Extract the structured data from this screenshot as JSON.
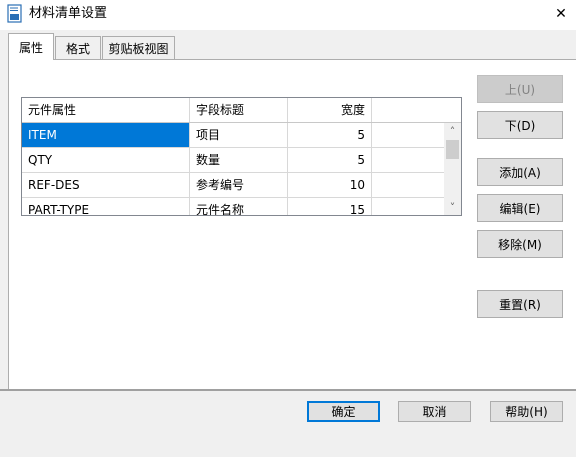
{
  "window": {
    "title": "材料清单设置",
    "icon": "app-document-icon",
    "close_glyph": "✕"
  },
  "tabs": [
    {
      "label": "属性",
      "active": true
    },
    {
      "label": "格式",
      "active": false
    },
    {
      "label": "剪贴板视图",
      "active": false
    }
  ],
  "grid": {
    "columns": [
      "元件属性",
      "字段标题",
      "宽度"
    ],
    "rows": [
      {
        "attribute": "ITEM",
        "title": "项目",
        "width": "5",
        "selected": true
      },
      {
        "attribute": "QTY",
        "title": "数量",
        "width": "5",
        "selected": false
      },
      {
        "attribute": "REF-DES",
        "title": "参考编号",
        "width": "10",
        "selected": false
      },
      {
        "attribute": "PART-TYPE",
        "title": "元件名称",
        "width": "15",
        "selected": false
      }
    ],
    "scrollbar": {
      "up_glyph": "˄",
      "down_glyph": "˅"
    }
  },
  "side_buttons": {
    "up": "上(U)",
    "down": "下(D)",
    "add": "添加(A)",
    "edit": "编辑(E)",
    "remove": "移除(M)",
    "reset": "重置(R)"
  },
  "footer_buttons": {
    "ok": "确定",
    "cancel": "取消",
    "help": "帮助(H)"
  },
  "colors": {
    "selection": "#0078d7",
    "default_button_border": "#0078d7"
  }
}
